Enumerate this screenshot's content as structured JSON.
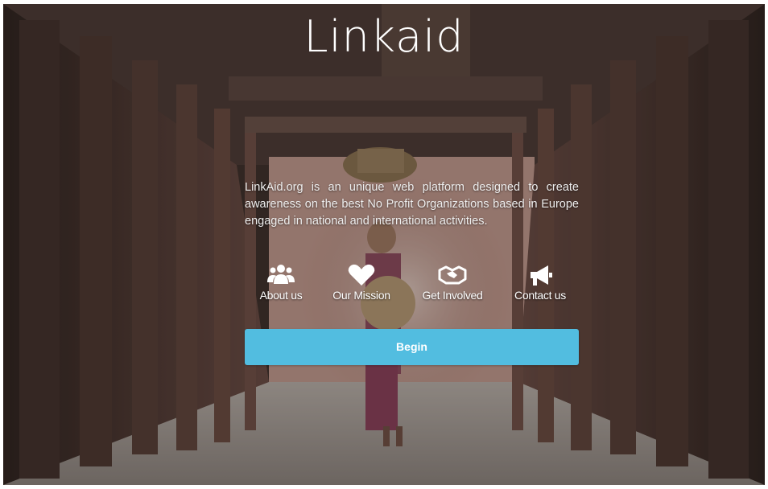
{
  "brand": {
    "logo_text": "Linkaid"
  },
  "intro": {
    "text": "LinkAid.org is an unique web platform designed to create awareness on the best No Profit Organizations based in Europe engaged in national and international activities."
  },
  "nav": {
    "items": [
      {
        "label": "About us",
        "icon": "users-icon"
      },
      {
        "label": "Our Mission",
        "icon": "heart-icon"
      },
      {
        "label": "Get Involved",
        "icon": "handshake-icon"
      },
      {
        "label": "Contact us",
        "icon": "megaphone-icon"
      }
    ]
  },
  "cta": {
    "label": "Begin"
  },
  "colors": {
    "accent": "#52bde0",
    "text": "#ffffff"
  }
}
